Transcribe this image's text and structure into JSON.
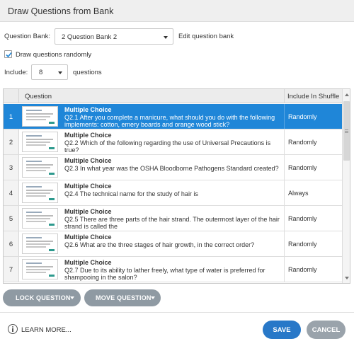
{
  "dialog": {
    "title": "Draw Questions from Bank"
  },
  "question_bank": {
    "label": "Question Bank:",
    "selected": "2 Question Bank 2",
    "edit_link": "Edit question bank"
  },
  "draw_randomly": {
    "label": "Draw questions randomly",
    "checked": true
  },
  "include": {
    "label": "Include:",
    "value": "8",
    "suffix": "questions"
  },
  "table": {
    "headers": {
      "question": "Question",
      "shuffle": "Include In Shuffle"
    },
    "rows": [
      {
        "num": "1",
        "type": "Multiple Choice",
        "text": "Q2.1 After you complete a manicure, what should you do with the following implements: cotton, emery boards and orange wood stick?",
        "shuffle": "Randomly",
        "selected": true
      },
      {
        "num": "2",
        "type": "Multiple Choice",
        "text": "Q2.2 Which of the following regarding the use of Universal Precautions is true?",
        "shuffle": "Randomly",
        "selected": false
      },
      {
        "num": "3",
        "type": "Multiple Choice",
        "text": "Q2.3 In what year was the OSHA Bloodborne Pathogens Standard created?",
        "shuffle": "Randomly",
        "selected": false
      },
      {
        "num": "4",
        "type": "Multiple Choice",
        "text": "Q2.4 The technical name for the study of hair is",
        "shuffle": "Always",
        "selected": false
      },
      {
        "num": "5",
        "type": "Multiple Choice",
        "text": "Q2.5 There are three parts of the hair strand. The outermost layer of the hair strand is called the",
        "shuffle": "Randomly",
        "selected": false
      },
      {
        "num": "6",
        "type": "Multiple Choice",
        "text": "Q2.6 What are the three stages of hair growth, in the correct order?",
        "shuffle": "Randomly",
        "selected": false
      },
      {
        "num": "7",
        "type": "Multiple Choice",
        "text": "Q2.7 Due to its ability to lather freely, what type of water is preferred for shampooing in the salon?",
        "shuffle": "Randomly",
        "selected": false
      }
    ]
  },
  "actions": {
    "lock": "LOCK QUESTION",
    "move": "MOVE QUESTION"
  },
  "footer": {
    "learn_more": "LEARN MORE...",
    "save": "SAVE",
    "cancel": "CANCEL"
  },
  "colors": {
    "selected_row": "#1f86d8",
    "save": "#2878c8",
    "secondary_button": "#8f9aa3"
  }
}
